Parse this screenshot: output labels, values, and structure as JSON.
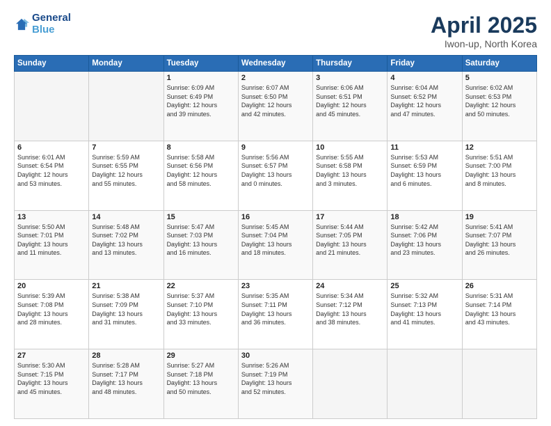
{
  "logo": {
    "line1": "General",
    "line2": "Blue"
  },
  "title": "April 2025",
  "subtitle": "Iwon-up, North Korea",
  "header_days": [
    "Sunday",
    "Monday",
    "Tuesday",
    "Wednesday",
    "Thursday",
    "Friday",
    "Saturday"
  ],
  "weeks": [
    [
      {
        "day": "",
        "info": ""
      },
      {
        "day": "",
        "info": ""
      },
      {
        "day": "1",
        "info": "Sunrise: 6:09 AM\nSunset: 6:49 PM\nDaylight: 12 hours\nand 39 minutes."
      },
      {
        "day": "2",
        "info": "Sunrise: 6:07 AM\nSunset: 6:50 PM\nDaylight: 12 hours\nand 42 minutes."
      },
      {
        "day": "3",
        "info": "Sunrise: 6:06 AM\nSunset: 6:51 PM\nDaylight: 12 hours\nand 45 minutes."
      },
      {
        "day": "4",
        "info": "Sunrise: 6:04 AM\nSunset: 6:52 PM\nDaylight: 12 hours\nand 47 minutes."
      },
      {
        "day": "5",
        "info": "Sunrise: 6:02 AM\nSunset: 6:53 PM\nDaylight: 12 hours\nand 50 minutes."
      }
    ],
    [
      {
        "day": "6",
        "info": "Sunrise: 6:01 AM\nSunset: 6:54 PM\nDaylight: 12 hours\nand 53 minutes."
      },
      {
        "day": "7",
        "info": "Sunrise: 5:59 AM\nSunset: 6:55 PM\nDaylight: 12 hours\nand 55 minutes."
      },
      {
        "day": "8",
        "info": "Sunrise: 5:58 AM\nSunset: 6:56 PM\nDaylight: 12 hours\nand 58 minutes."
      },
      {
        "day": "9",
        "info": "Sunrise: 5:56 AM\nSunset: 6:57 PM\nDaylight: 13 hours\nand 0 minutes."
      },
      {
        "day": "10",
        "info": "Sunrise: 5:55 AM\nSunset: 6:58 PM\nDaylight: 13 hours\nand 3 minutes."
      },
      {
        "day": "11",
        "info": "Sunrise: 5:53 AM\nSunset: 6:59 PM\nDaylight: 13 hours\nand 6 minutes."
      },
      {
        "day": "12",
        "info": "Sunrise: 5:51 AM\nSunset: 7:00 PM\nDaylight: 13 hours\nand 8 minutes."
      }
    ],
    [
      {
        "day": "13",
        "info": "Sunrise: 5:50 AM\nSunset: 7:01 PM\nDaylight: 13 hours\nand 11 minutes."
      },
      {
        "day": "14",
        "info": "Sunrise: 5:48 AM\nSunset: 7:02 PM\nDaylight: 13 hours\nand 13 minutes."
      },
      {
        "day": "15",
        "info": "Sunrise: 5:47 AM\nSunset: 7:03 PM\nDaylight: 13 hours\nand 16 minutes."
      },
      {
        "day": "16",
        "info": "Sunrise: 5:45 AM\nSunset: 7:04 PM\nDaylight: 13 hours\nand 18 minutes."
      },
      {
        "day": "17",
        "info": "Sunrise: 5:44 AM\nSunset: 7:05 PM\nDaylight: 13 hours\nand 21 minutes."
      },
      {
        "day": "18",
        "info": "Sunrise: 5:42 AM\nSunset: 7:06 PM\nDaylight: 13 hours\nand 23 minutes."
      },
      {
        "day": "19",
        "info": "Sunrise: 5:41 AM\nSunset: 7:07 PM\nDaylight: 13 hours\nand 26 minutes."
      }
    ],
    [
      {
        "day": "20",
        "info": "Sunrise: 5:39 AM\nSunset: 7:08 PM\nDaylight: 13 hours\nand 28 minutes."
      },
      {
        "day": "21",
        "info": "Sunrise: 5:38 AM\nSunset: 7:09 PM\nDaylight: 13 hours\nand 31 minutes."
      },
      {
        "day": "22",
        "info": "Sunrise: 5:37 AM\nSunset: 7:10 PM\nDaylight: 13 hours\nand 33 minutes."
      },
      {
        "day": "23",
        "info": "Sunrise: 5:35 AM\nSunset: 7:11 PM\nDaylight: 13 hours\nand 36 minutes."
      },
      {
        "day": "24",
        "info": "Sunrise: 5:34 AM\nSunset: 7:12 PM\nDaylight: 13 hours\nand 38 minutes."
      },
      {
        "day": "25",
        "info": "Sunrise: 5:32 AM\nSunset: 7:13 PM\nDaylight: 13 hours\nand 41 minutes."
      },
      {
        "day": "26",
        "info": "Sunrise: 5:31 AM\nSunset: 7:14 PM\nDaylight: 13 hours\nand 43 minutes."
      }
    ],
    [
      {
        "day": "27",
        "info": "Sunrise: 5:30 AM\nSunset: 7:15 PM\nDaylight: 13 hours\nand 45 minutes."
      },
      {
        "day": "28",
        "info": "Sunrise: 5:28 AM\nSunset: 7:17 PM\nDaylight: 13 hours\nand 48 minutes."
      },
      {
        "day": "29",
        "info": "Sunrise: 5:27 AM\nSunset: 7:18 PM\nDaylight: 13 hours\nand 50 minutes."
      },
      {
        "day": "30",
        "info": "Sunrise: 5:26 AM\nSunset: 7:19 PM\nDaylight: 13 hours\nand 52 minutes."
      },
      {
        "day": "",
        "info": ""
      },
      {
        "day": "",
        "info": ""
      },
      {
        "day": "",
        "info": ""
      }
    ]
  ]
}
